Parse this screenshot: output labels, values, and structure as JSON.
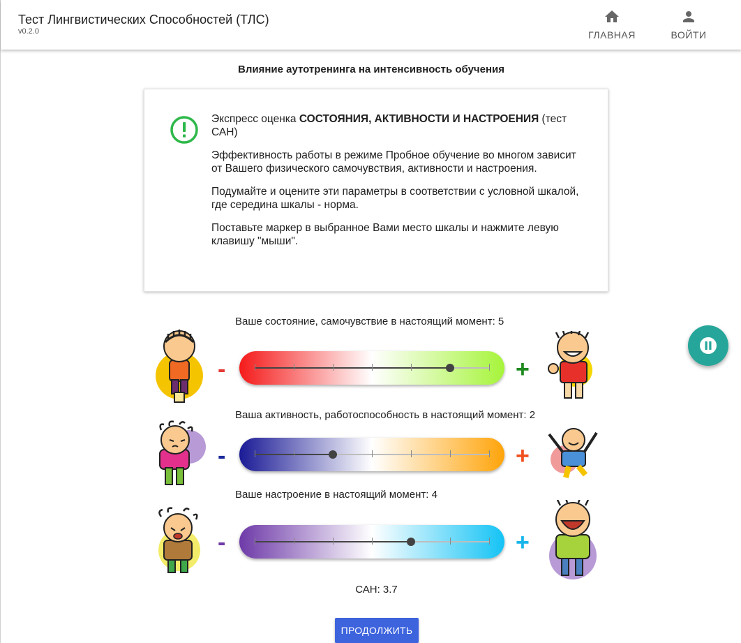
{
  "app": {
    "title": "Тест Лингвистических Способностей (ТЛС)",
    "version": "v0.2.0"
  },
  "nav": {
    "home_label": "ГЛАВНАЯ",
    "login_label": "ВОЙТИ"
  },
  "page": {
    "heading": "Влияние аутотренинга на интенсивность обучения"
  },
  "info": {
    "intro_prefix": "Экспресс оценка ",
    "intro_bold": "СОСТОЯНИЯ, АКТИВНОСТИ И НАСТРОЕНИЯ",
    "intro_suffix": " (тест САН)",
    "p2": "Эффективность работы в режиме Пробное обучение во многом зависит от Вашего физического самочувствия, активности и настроения.",
    "p3": "Подумайте и оцените эти параметры в соответствии с условной шкалой, где середина шкалы - норма.",
    "p4": "Поставьте маркер в выбранное Вами место шкалы и нажмите левую клавишу \"мыши\"."
  },
  "scales": [
    {
      "label": "Ваше состояние, самочувствие в настоящий момент: 5",
      "value": 5,
      "min": 0,
      "max": 6,
      "gradient": [
        "#f51a1a",
        "#ffffff",
        "#a6f43a"
      ],
      "minus": "-",
      "plus": "+",
      "minus_color": "#e53935",
      "plus_color": "#1f8a1f"
    },
    {
      "label": "Ваша активность, работоспособность в настоящий момент: 2",
      "value": 2,
      "min": 0,
      "max": 6,
      "gradient": [
        "#1a1a96",
        "#ffffff",
        "#ffa40a"
      ],
      "minus": "-",
      "plus": "+",
      "minus_color": "#1a2a9a",
      "plus_color": "#f0501e"
    },
    {
      "label": "Ваше настроение в настоящий момент: 4",
      "value": 4,
      "min": 0,
      "max": 6,
      "gradient": [
        "#6e3aa8",
        "#ffffff",
        "#14c3f5"
      ],
      "minus": "-",
      "plus": "+",
      "minus_color": "#6e3aa8",
      "plus_color": "#18b6ea"
    }
  ],
  "result": {
    "label": "САН: 3.7"
  },
  "actions": {
    "continue_label": "ПРОДОЛЖИТЬ"
  },
  "icons": {
    "home": "home-icon",
    "user": "account-icon",
    "alert": "alert-circle-icon",
    "pause": "pause-icon"
  }
}
